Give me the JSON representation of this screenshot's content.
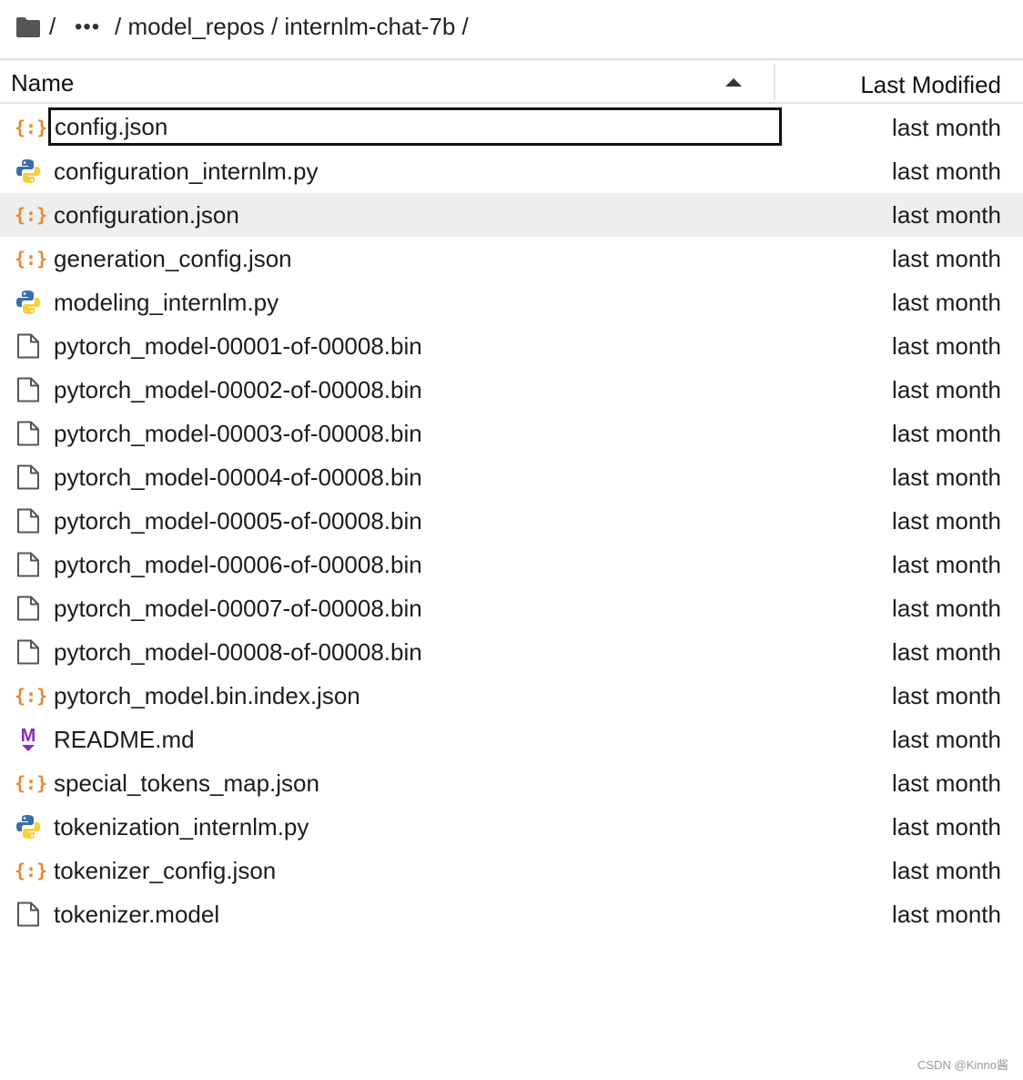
{
  "breadcrumb": {
    "folder_icon": "folder-icon",
    "sep": "/",
    "dots": "•••",
    "path": "/ model_repos / internlm-chat-7b /"
  },
  "header": {
    "name": "Name",
    "last_modified": "Last Modified"
  },
  "files": [
    {
      "name": "config.json",
      "type": "json",
      "modified": "last month"
    },
    {
      "name": "configuration_internlm.py",
      "type": "python",
      "modified": "last month"
    },
    {
      "name": "configuration.json",
      "type": "json",
      "modified": "last month"
    },
    {
      "name": "generation_config.json",
      "type": "json",
      "modified": "last month"
    },
    {
      "name": "modeling_internlm.py",
      "type": "python",
      "modified": "last month"
    },
    {
      "name": "pytorch_model-00001-of-00008.bin",
      "type": "file",
      "modified": "last month"
    },
    {
      "name": "pytorch_model-00002-of-00008.bin",
      "type": "file",
      "modified": "last month"
    },
    {
      "name": "pytorch_model-00003-of-00008.bin",
      "type": "file",
      "modified": "last month"
    },
    {
      "name": "pytorch_model-00004-of-00008.bin",
      "type": "file",
      "modified": "last month"
    },
    {
      "name": "pytorch_model-00005-of-00008.bin",
      "type": "file",
      "modified": "last month"
    },
    {
      "name": "pytorch_model-00006-of-00008.bin",
      "type": "file",
      "modified": "last month"
    },
    {
      "name": "pytorch_model-00007-of-00008.bin",
      "type": "file",
      "modified": "last month"
    },
    {
      "name": "pytorch_model-00008-of-00008.bin",
      "type": "file",
      "modified": "last month"
    },
    {
      "name": "pytorch_model.bin.index.json",
      "type": "json",
      "modified": "last month"
    },
    {
      "name": "README.md",
      "type": "markdown",
      "modified": "last month"
    },
    {
      "name": "special_tokens_map.json",
      "type": "json",
      "modified": "last month"
    },
    {
      "name": "tokenization_internlm.py",
      "type": "python",
      "modified": "last month"
    },
    {
      "name": "tokenizer_config.json",
      "type": "json",
      "modified": "last month"
    },
    {
      "name": "tokenizer.model",
      "type": "file",
      "modified": "last month"
    }
  ],
  "editing_file": "config.json",
  "highlighted_file": "configuration.json",
  "colors": {
    "json_icon": "#e7862f",
    "markdown_icon": "#8a2db5",
    "python_blue": "#3a6fa6",
    "python_yellow": "#f6cf3e",
    "row_highlight": "#eeeeee"
  },
  "watermark": "CSDN @Kinno酱"
}
